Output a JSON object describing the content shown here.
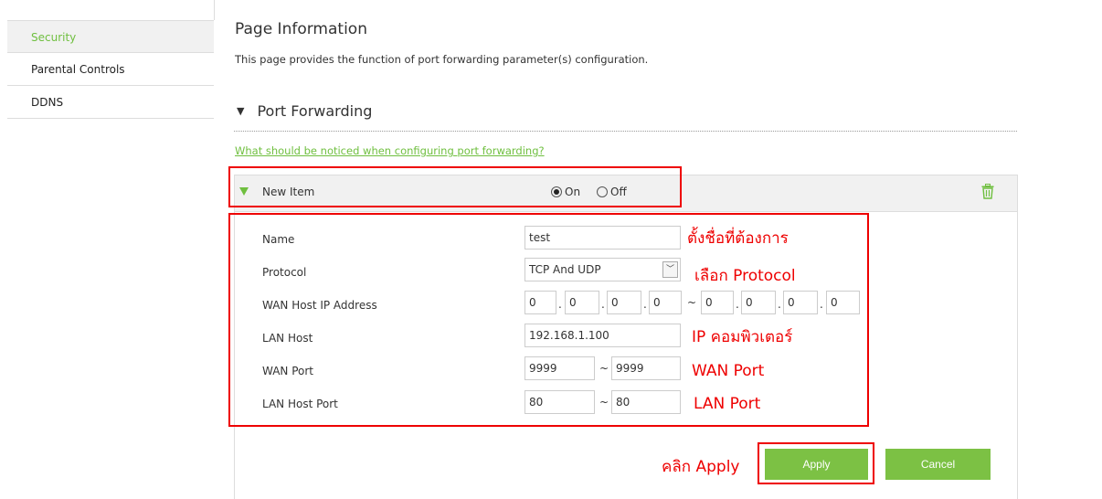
{
  "sidebar": {
    "items": [
      {
        "label": "Security",
        "active": true
      },
      {
        "label": "Parental Controls",
        "active": false
      },
      {
        "label": "DDNS",
        "active": false
      }
    ]
  },
  "page": {
    "title": "Page Information",
    "description": "This page provides the function of port forwarding parameter(s) configuration."
  },
  "section": {
    "title": "Port Forwarding",
    "help_link": "What should be noticed when configuring port forwarding?"
  },
  "item": {
    "title": "New Item",
    "on_label": "On",
    "off_label": "Off",
    "selected": "On"
  },
  "form": {
    "name_label": "Name",
    "name_value": "test",
    "protocol_label": "Protocol",
    "protocol_value": "TCP And UDP",
    "wan_ip_label": "WAN Host IP Address",
    "wan_ip_start": [
      "0",
      "0",
      "0",
      "0"
    ],
    "wan_ip_end": [
      "0",
      "0",
      "0",
      "0"
    ],
    "lan_host_label": "LAN Host",
    "lan_host_value": "192.168.1.100",
    "wan_port_label": "WAN Port",
    "wan_port_start": "9999",
    "wan_port_end": "9999",
    "lan_port_label": "LAN Host Port",
    "lan_port_start": "80",
    "lan_port_end": "80",
    "dot": ".",
    "tilde": "~"
  },
  "annotations": {
    "name_note": "ตั้งชื่อที่ต้องการ",
    "protocol_note": "เลือก Protocol",
    "lan_host_note": "IP คอมพิวเตอร์",
    "wan_port_note": "WAN Port",
    "lan_port_note": "LAN Port",
    "apply_note": "คลิก Apply"
  },
  "buttons": {
    "apply": "Apply",
    "cancel": "Cancel"
  },
  "colors": {
    "accent": "#7cc144",
    "annotation": "#e00000"
  },
  "icons": {
    "trash": "trash-icon",
    "dropdown": "chevron-down-icon"
  }
}
